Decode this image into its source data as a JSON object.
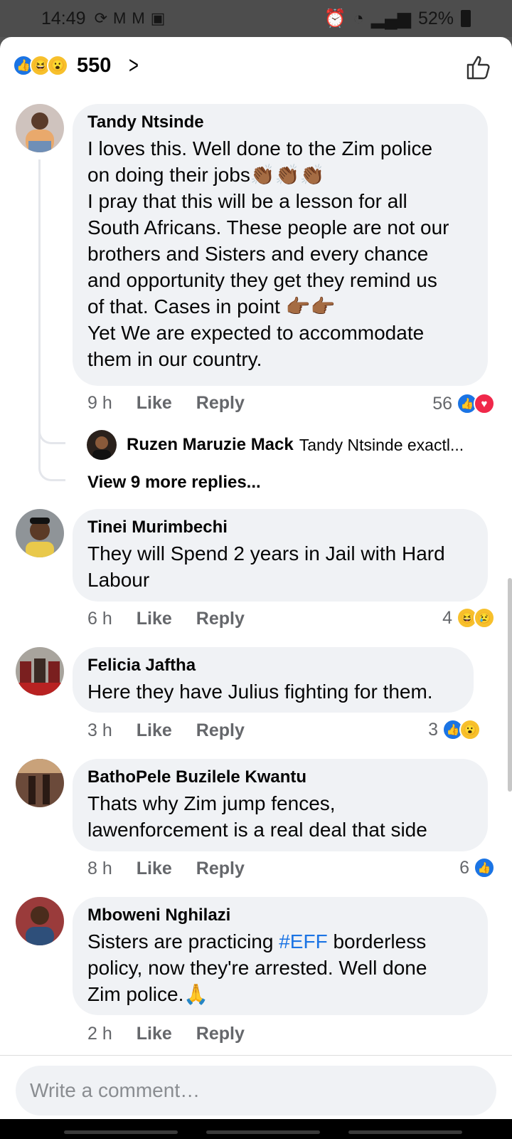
{
  "status_bar": {
    "time": "14:49",
    "battery": "52%"
  },
  "header": {
    "reaction_count": "550"
  },
  "comments": [
    {
      "author": "Tandy Ntsinde",
      "lines": [
        "I loves this. Well done to the Zim police",
        "on doing their jobs👏🏾👏🏾👏🏾",
        "I pray that this will be a lesson for all",
        "South Africans. These people are not our",
        "brothers and Sisters and every chance",
        "and opportunity they get they remind us",
        "of that. Cases in point 👉🏾👉🏾",
        "Yet We are expected to accommodate",
        "them in our country."
      ],
      "time": "9 h",
      "like": "Like",
      "reply": "Reply",
      "reaction_count": "56",
      "reply_preview": {
        "author": "Ruzen Maruzie Mack",
        "text": "Tandy Ntsinde exactl..."
      },
      "view_more": "View 9 more replies..."
    },
    {
      "author": "Tinei Murimbechi",
      "lines": [
        "They will Spend 2 years in Jail with Hard",
        "Labour"
      ],
      "time": "6 h",
      "like": "Like",
      "reply": "Reply",
      "reaction_count": "4"
    },
    {
      "author": "Felicia Jaftha",
      "lines": [
        "Here they have Julius fighting for them."
      ],
      "time": "3 h",
      "like": "Like",
      "reply": "Reply",
      "reaction_count": "3"
    },
    {
      "author": "BathoPele Buzilele Kwantu",
      "lines": [
        "Thats why Zim jump fences,",
        "lawenforcement is a real deal that side"
      ],
      "time": "8 h",
      "like": "Like",
      "reply": "Reply",
      "reaction_count": "6"
    },
    {
      "author": "Mboweni Nghilazi",
      "line1_pre": "Sisters are practicing ",
      "hashtag": "#EFF",
      "line1_post": " borderless",
      "lines": [
        "policy, now they're arrested. Well done",
        "Zim police.🙏"
      ],
      "time": "2 h",
      "like": "Like",
      "reply": "Reply"
    }
  ],
  "composer": {
    "placeholder": "Write a comment…"
  }
}
